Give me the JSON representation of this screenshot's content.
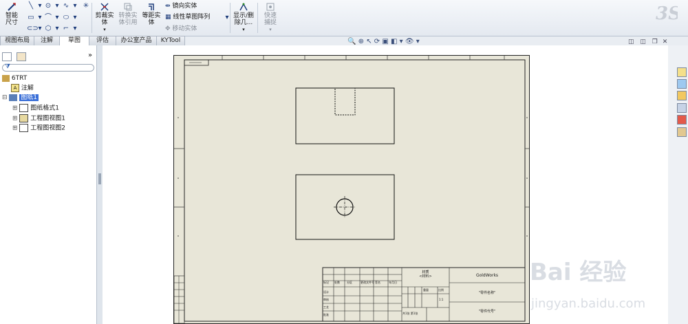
{
  "ribbon": {
    "smart_dimension": "智能尺寸",
    "trim": "剪裁实体",
    "convert": "转换实体引用",
    "offset": "等距实体",
    "mirror": "镜向实体",
    "linear_pattern": "线性草图阵列",
    "move": "移动实体",
    "display_delete": "显示/删除几...",
    "quick_snap": "快速捕捉"
  },
  "tabs": [
    "视图布局",
    "注解",
    "草图",
    "评估",
    "办公室产品",
    "KYTool"
  ],
  "active_tab": "草图",
  "tree": {
    "root": "6TRT",
    "items": [
      {
        "label": "注解",
        "icon": "annotation-icon"
      },
      {
        "label": "图纸1",
        "icon": "sheet-icon",
        "selected": true
      },
      {
        "label": "图纸格式1",
        "icon": "sheet-format-icon"
      },
      {
        "label": "工程图视图1",
        "icon": "drawing-view-icon"
      },
      {
        "label": "工程图视图2",
        "icon": "drawing-view-icon"
      }
    ],
    "collapse_label": "»"
  },
  "title_block": {
    "company": "GoldWorks",
    "material": "材质",
    "material_sub": "<材料>",
    "name_placeholder": "\"零件名称\"",
    "number_placeholder": "\"零件代号\"",
    "scale_label": "比例",
    "scale_value": "1:1",
    "weight_label": "重量",
    "sheet_label": "共1张 第1张",
    "rows": [
      "设计",
      "审核",
      "工艺",
      "批准"
    ],
    "header_cells": [
      "标记",
      "处数",
      "分区",
      "更改文件号",
      "签名",
      "年月日"
    ]
  },
  "watermark": {
    "brand": "Bai 经验",
    "url": "jingyan.baidu.com"
  },
  "colors": {
    "sheet": "#e8e6d8",
    "selected": "#3a6fd8",
    "accent": "#1c3b7a"
  }
}
